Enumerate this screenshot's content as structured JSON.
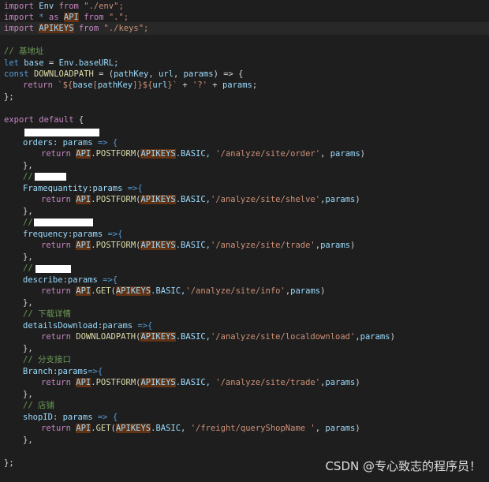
{
  "code": {
    "line1": [
      "import",
      "Env",
      "from",
      "\"./env\";"
    ],
    "line2": [
      "import",
      "*",
      "as",
      "API",
      "from",
      "\".\";"
    ],
    "line3": [
      "import",
      "APIKEYS",
      "from",
      "\"./keys\";"
    ],
    "line5": "// 基地址",
    "line6": [
      "let",
      "base",
      "=",
      "Env",
      ".baseURL;"
    ],
    "line7": [
      "const",
      "DOWNLOADPATH",
      "= (",
      "pathKey",
      ", ",
      "url",
      ", ",
      "params",
      ") => {"
    ],
    "line8": [
      "return",
      "`${",
      "base",
      "[",
      "pathKey",
      "]}${",
      "url",
      "}`",
      " + ",
      "'?'",
      " + ",
      "params",
      ";"
    ],
    "line9": "};",
    "line11": [
      "export",
      "default",
      "{"
    ],
    "line13": [
      "orders",
      ": ",
      "params",
      " => {"
    ],
    "line14": [
      "return",
      "API",
      ".",
      "POSTFORM",
      "(",
      "APIKEYS",
      ".BASIC, ",
      "'/analyze/site/order'",
      ", ",
      "params",
      ")"
    ],
    "close": "},",
    "line16": "//",
    "line17": [
      "Framequantity",
      ":",
      "params",
      " =>{"
    ],
    "line18": [
      "return",
      "API",
      ".",
      "POSTFORM",
      "(",
      "APIKEYS",
      ".BASIC,",
      "'/analyze/site/shelve'",
      ",",
      "params",
      ")"
    ],
    "line20": "//",
    "line21": [
      "frequency",
      ":",
      "params",
      " =>{"
    ],
    "line22": [
      "return",
      "API",
      ".",
      "POSTFORM",
      "(",
      "APIKEYS",
      ".BASIC,",
      "'/analyze/site/trade'",
      ",",
      "params",
      ")"
    ],
    "line24": "//",
    "line25": [
      "describe",
      ":",
      "params",
      " =>{"
    ],
    "line26": [
      "return",
      "API",
      ".",
      "GET",
      "(",
      "APIKEYS",
      ".BASIC,",
      "'/analyze/site/info'",
      ",",
      "params",
      ")"
    ],
    "line28": "// 下载详情",
    "line29": [
      "detailsDownload",
      ":",
      "params",
      " =>{"
    ],
    "line30": [
      "return",
      "DOWNLOADPATH",
      "(",
      "APIKEYS",
      ".BASIC,",
      "'/analyze/site/localdownload'",
      ",",
      "params",
      ")"
    ],
    "line32": "// 分支接口",
    "line33": [
      "Branch",
      ":",
      "params",
      "=>{"
    ],
    "line34": [
      "return",
      "API",
      ".",
      "POSTFORM",
      "(",
      "APIKEYS",
      ".BASIC, ",
      "'/analyze/site/trade'",
      ",",
      "params",
      ")"
    ],
    "line36": "// 店铺",
    "line37": [
      "shopID",
      ": ",
      "params",
      " => {"
    ],
    "line38": [
      "return",
      "API",
      ".",
      "GET",
      "(",
      "APIKEYS",
      ".BASIC, ",
      "'/freight/queryShopName '",
      ", ",
      "params",
      ")"
    ],
    "line41": "};"
  },
  "watermark": "CSDN @专心致志的程序员！",
  "colors": {
    "background": "#1e1e1e",
    "keyword": "#c586c0",
    "declaration": "#569cd6",
    "variable": "#9cdcfe",
    "string": "#ce9178",
    "function": "#dcdcaa",
    "comment": "#6a9955",
    "highlight": "#613214"
  }
}
